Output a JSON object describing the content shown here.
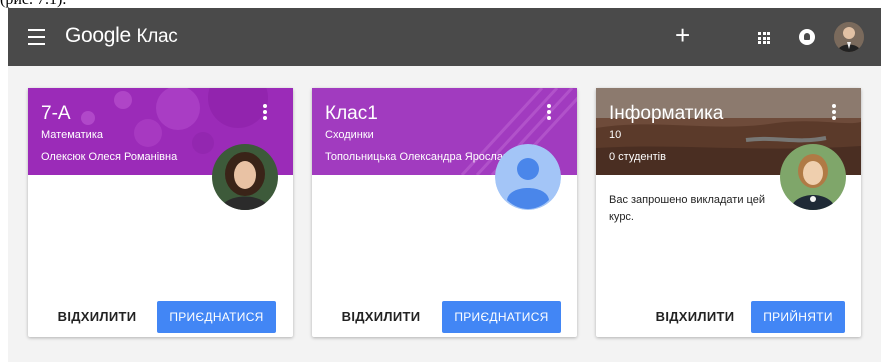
{
  "caption": "(рис. 7.1).",
  "app": {
    "brand_google": "Google",
    "brand_product": "Клас"
  },
  "topbar": {
    "plus_glyph": "+",
    "icons": [
      "menu-icon",
      "plus-icon",
      "apps-icon",
      "notifications-icon",
      "account-avatar"
    ]
  },
  "colors": {
    "topbar": "#4a4a4a",
    "background": "#f3f3f3",
    "primary_button": "#4286f5",
    "card1_header": "#9b2bb8",
    "card2_header": "#a13bbf",
    "card3_header": "#6e4b3a"
  },
  "cards": [
    {
      "title": "7-А",
      "subtitle": "Математика",
      "teacher": "Олексюк Олеся Романівна",
      "decline_label": "ВІДХИЛИТИ",
      "accept_label": "ПРИЄДНАТИСЯ"
    },
    {
      "title": "Клас1",
      "subtitle": "Сходинки",
      "teacher": "Топольницька Олександра Ярославівна",
      "decline_label": "ВІДХИЛИТИ",
      "accept_label": "ПРИЄДНАТИСЯ"
    },
    {
      "title": "Інформатика",
      "subtitle": "10",
      "students": "0 студентів",
      "invite_text": "Вас запрошено викладати цей курс.",
      "decline_label": "ВІДХИЛИТИ",
      "accept_label": "ПРИЙНЯТИ"
    }
  ]
}
